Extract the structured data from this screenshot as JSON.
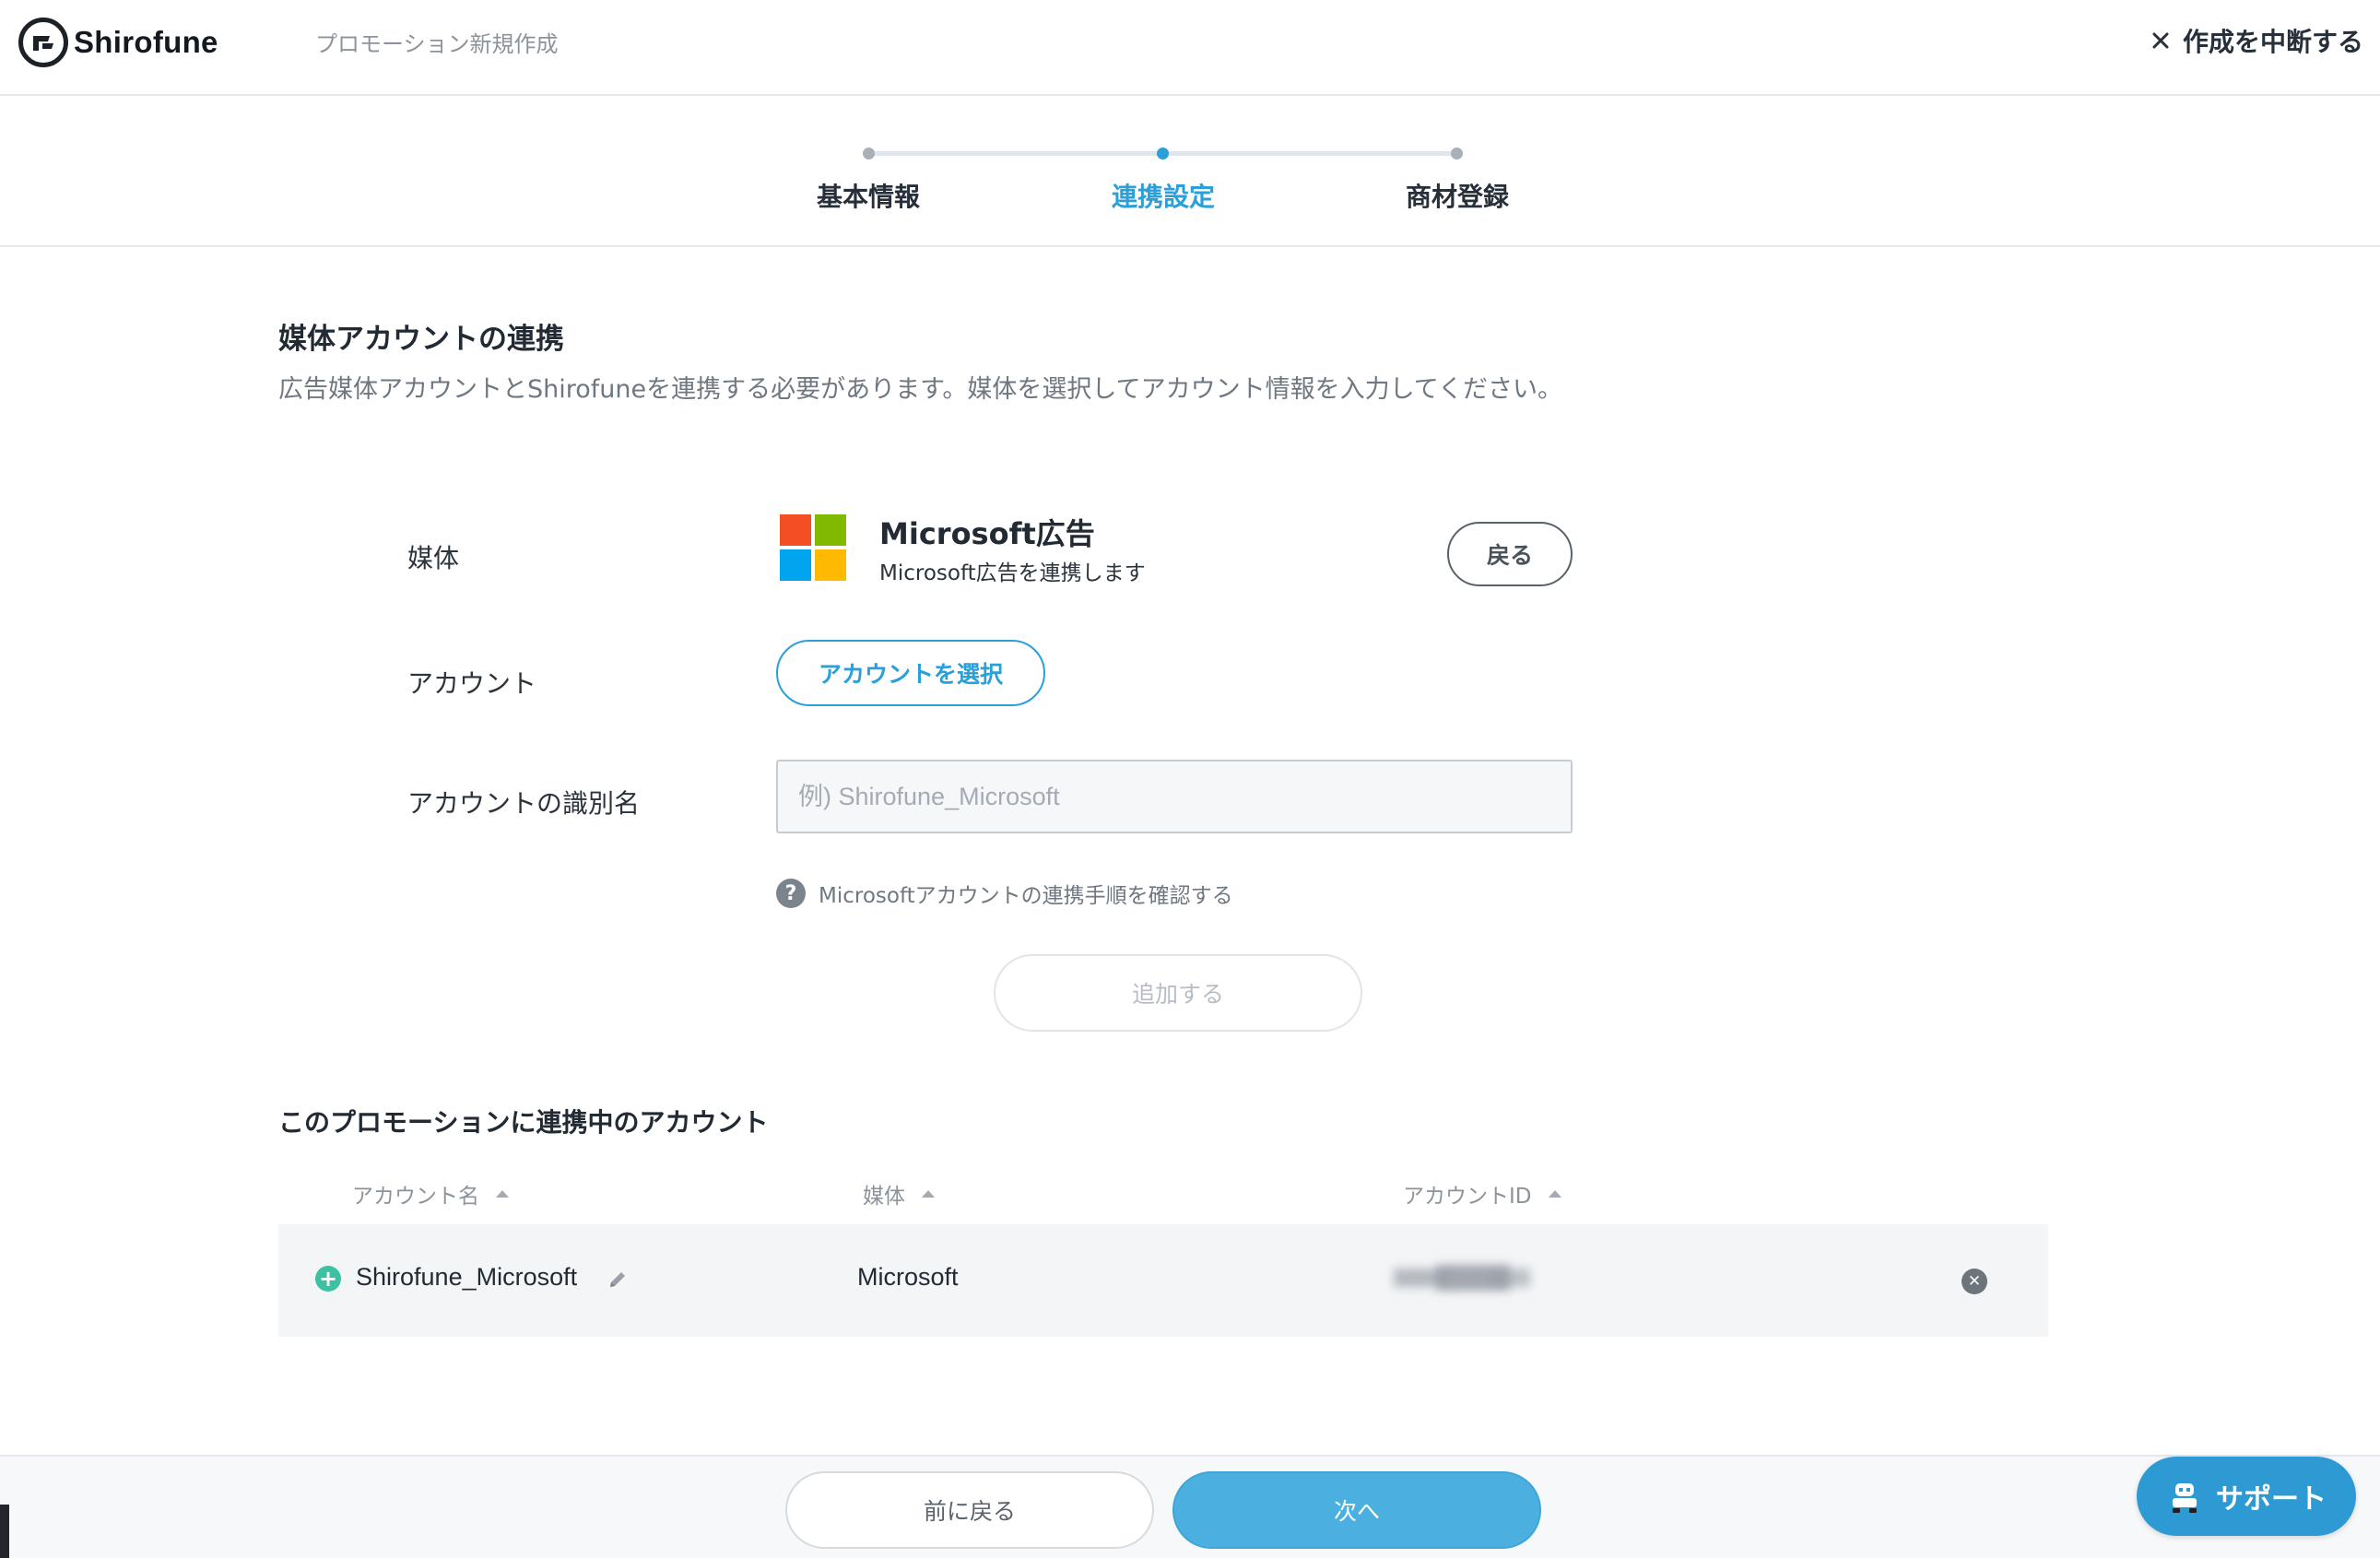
{
  "header": {
    "logo_text": "Shirofune",
    "page_title": "プロモーション新規作成",
    "abort_label": "作成を中断する",
    "abort_icon": "close-icon"
  },
  "stepper": {
    "steps": [
      {
        "label": "基本情報",
        "active": false
      },
      {
        "label": "連携設定",
        "active": true
      },
      {
        "label": "商材登録",
        "active": false
      }
    ]
  },
  "section": {
    "title": "媒体アカウントの連携",
    "description": "広告媒体アカウントとShirofuneを連携する必要があります。媒体を選択してアカウント情報を入力してください。"
  },
  "form": {
    "media_label": "媒体",
    "media_name": "Microsoft広告",
    "media_description": "Microsoft広告を連携します",
    "media_logo_colors": [
      "#f25022",
      "#7fba00",
      "#00a4ef",
      "#ffb900"
    ],
    "back_button": "戻る",
    "account_label": "アカウント",
    "select_account_button": "アカウントを選択",
    "account_name_label": "アカウントの識別名",
    "account_name_value": "",
    "account_name_placeholder": "例) Shirofune_Microsoft",
    "help_icon": "question-icon",
    "help_link": "Microsoftアカウントの連携手順を確認する",
    "add_button": "追加する"
  },
  "linked_accounts": {
    "title": "このプロモーションに連携中のアカウント",
    "columns": [
      "アカウント名",
      "媒体",
      "アカウントID"
    ],
    "rows": [
      {
        "account_name": "Shirofune_Microsoft",
        "media": "Microsoft",
        "account_id": ""
      }
    ]
  },
  "footer": {
    "prev_button": "前に戻る",
    "next_button": "次へ",
    "support_button": "サポート"
  },
  "colors": {
    "accent": "#2b9fd8",
    "next_button": "#4bb0e0",
    "support_button": "#2e9ad3",
    "add_icon": "#3cc2a2"
  }
}
